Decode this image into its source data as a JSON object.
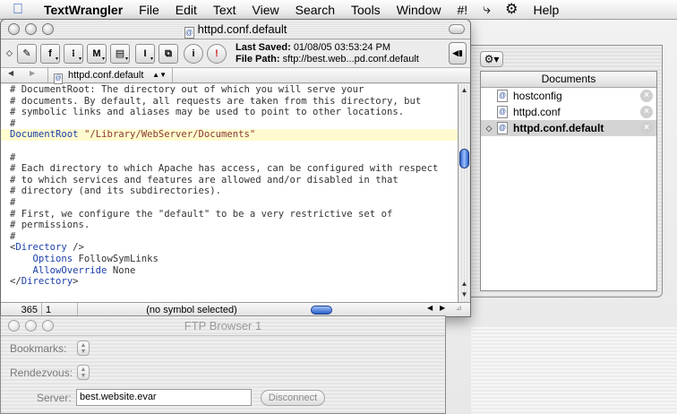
{
  "menubar": {
    "app": "TextWrangler",
    "items": [
      "File",
      "Edit",
      "Text",
      "View",
      "Search",
      "Tools",
      "Window",
      "#!"
    ],
    "help": "Help"
  },
  "editor_window": {
    "title": "httpd.conf.default",
    "last_saved_label": "Last Saved:",
    "last_saved_value": "01/08/05 03:53:24 PM",
    "file_path_label": "File Path:",
    "file_path_value": "sftp://best.web...pd.conf.default",
    "toolbar_buttons": [
      {
        "name": "pencil",
        "glyph": "✎"
      },
      {
        "name": "function",
        "glyph": "f"
      },
      {
        "name": "marker",
        "glyph": "⁝"
      },
      {
        "name": "mark",
        "glyph": "M"
      },
      {
        "name": "document",
        "glyph": "▤"
      },
      {
        "name": "text-cursor",
        "glyph": "I"
      },
      {
        "name": "copy",
        "glyph": "⧉"
      },
      {
        "name": "info",
        "glyph": "i"
      },
      {
        "name": "stop",
        "glyph": "!"
      }
    ],
    "nav_document": "httpd.conf.default",
    "code_lines": [
      "# DocumentRoot: The directory out of which you will serve your",
      "# documents. By default, all requests are taken from this directory, but",
      "# symbolic links and aliases may be used to point to other locations.",
      "#",
      "",
      "",
      "#",
      "# Each directory to which Apache has access, can be configured with respect",
      "# to which services and features are allowed and/or disabled in that",
      "# directory (and its subdirectories).",
      "#",
      "# First, we configure the \"default\" to be a very restrictive set of",
      "# permissions.",
      "#",
      "",
      "",
      "",
      "",
      ""
    ],
    "documentroot_line": {
      "directive": "DocumentRoot",
      "value": "\"/Library/WebServer/Documents\""
    },
    "directory_open": {
      "open": "<",
      "tag": "Directory",
      "rest": " />"
    },
    "options_line": {
      "directive": "Options",
      "value": " FollowSymLinks"
    },
    "allowoverride_line": {
      "directive": "AllowOverride",
      "value": " None"
    },
    "directory_close": {
      "open": "</",
      "tag": "Directory",
      "rest": ">"
    },
    "status_line": "365",
    "status_col": "1",
    "status_symbol": "(no symbol selected)"
  },
  "documents_drawer": {
    "header": "Documents",
    "items": [
      {
        "name": "hostconfig",
        "active": false
      },
      {
        "name": "httpd.conf",
        "active": false
      },
      {
        "name": "httpd.conf.default",
        "active": true
      }
    ]
  },
  "ftp_browser": {
    "title": "FTP Browser 1",
    "bookmarks_label": "Bookmarks:",
    "rendezvous_label": "Rendezvous:",
    "server_label": "Server:",
    "server_value": "best.website.evar",
    "disconnect_label": "Disconnect"
  }
}
